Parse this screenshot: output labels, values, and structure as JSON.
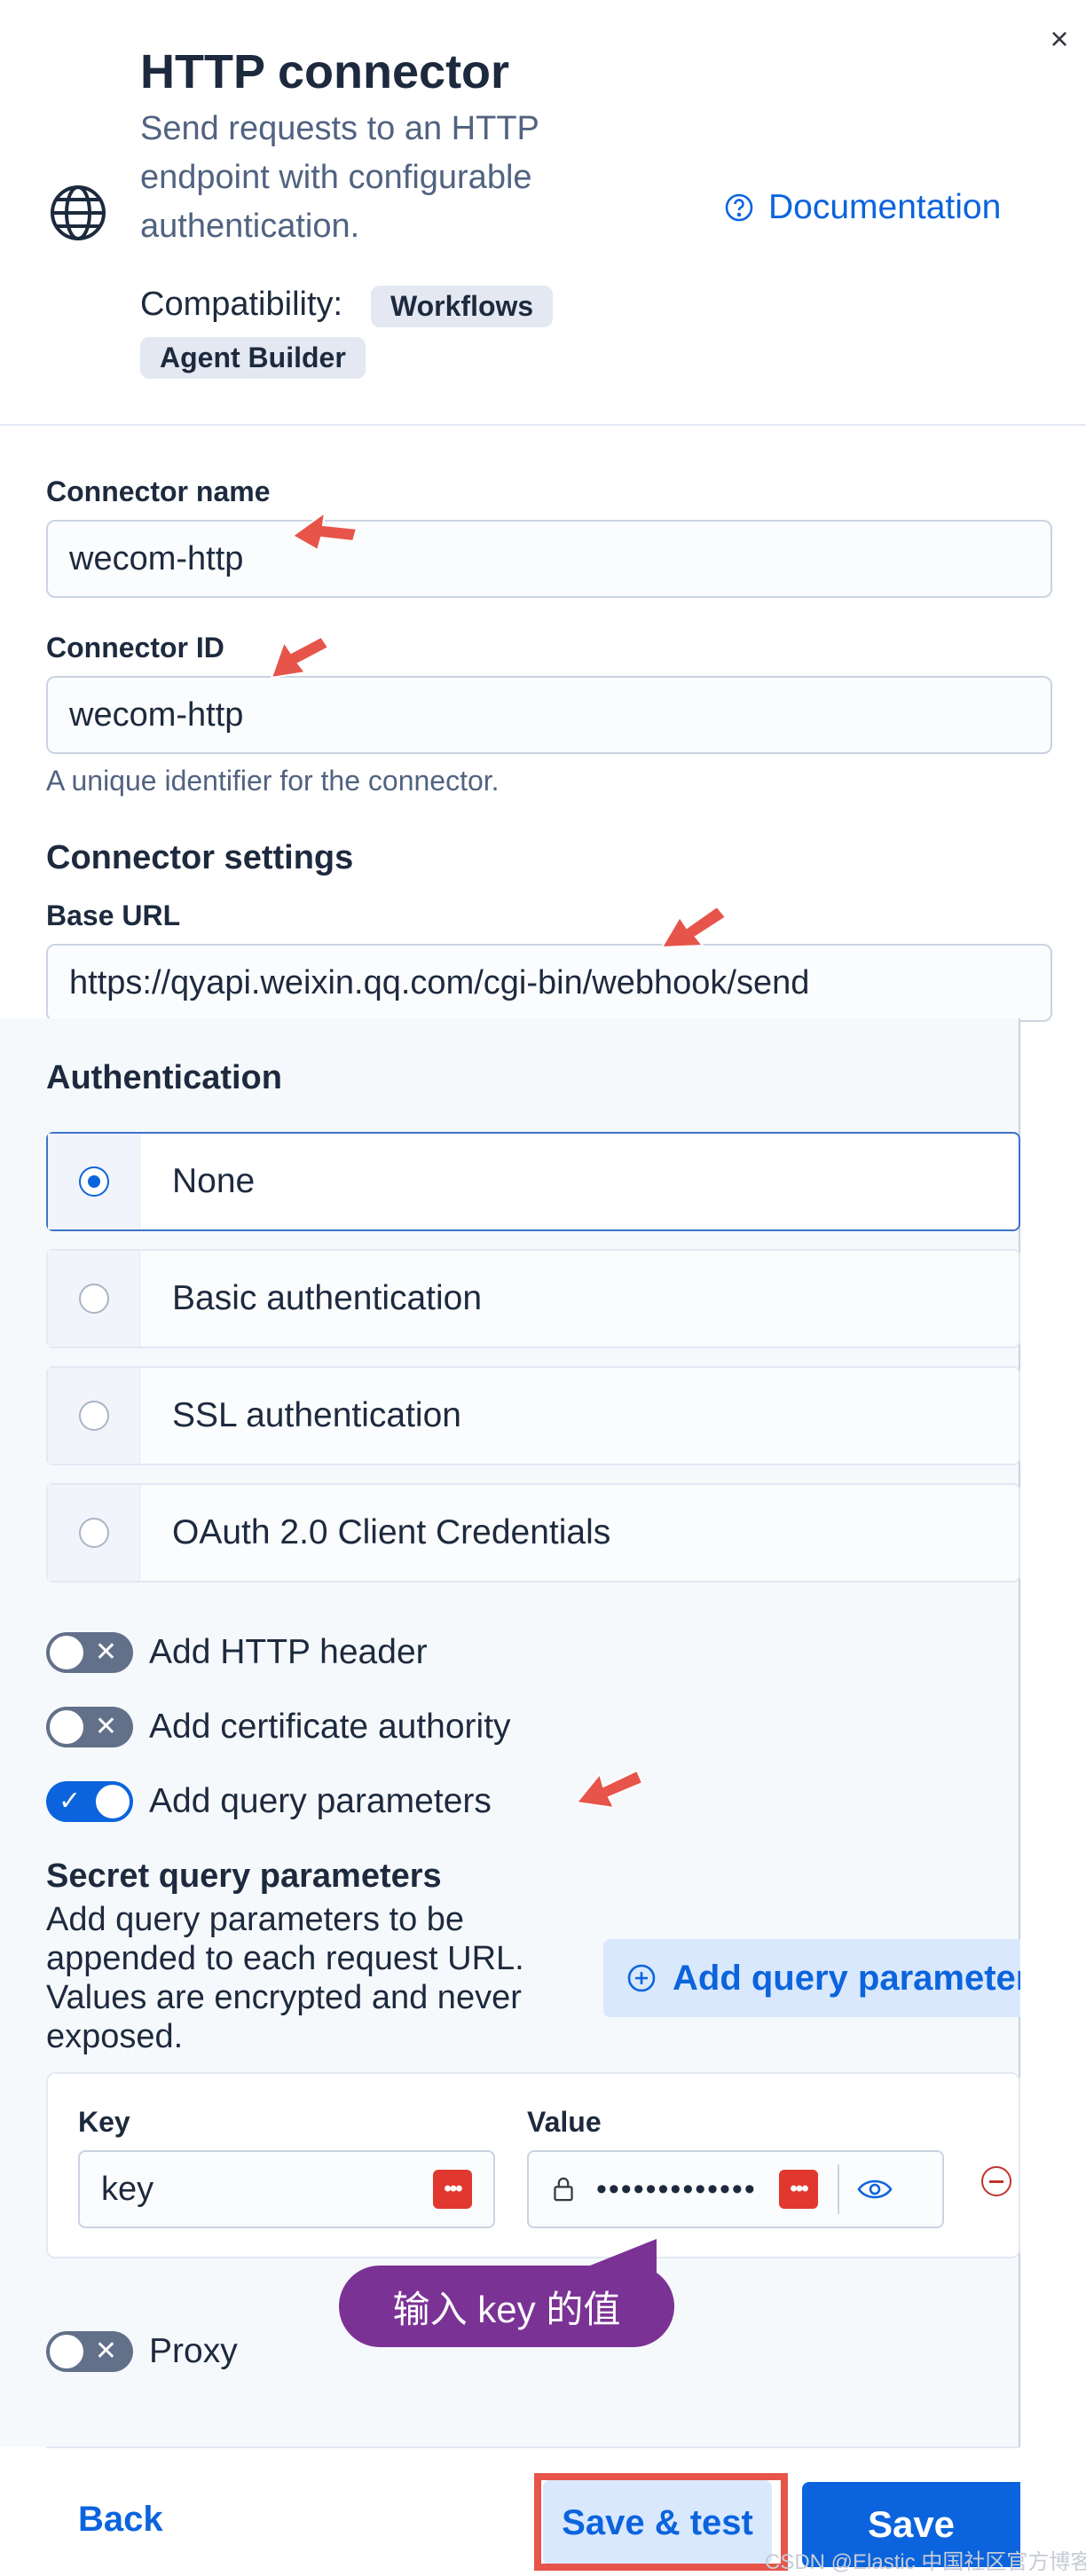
{
  "header": {
    "title": "HTTP connector",
    "description": "Send requests to an HTTP endpoint with configurable authentication.",
    "documentation_label": "Documentation",
    "compatibility_label": "Compatibility:",
    "compatibility_badges": [
      "Workflows",
      "Agent Builder"
    ]
  },
  "form": {
    "connector_name": {
      "label": "Connector name",
      "value": "wecom-http"
    },
    "connector_id": {
      "label": "Connector ID",
      "value": "wecom-http",
      "help": "A unique identifier for the connector."
    },
    "settings_title": "Connector settings",
    "base_url": {
      "label": "Base URL",
      "value": "https://qyapi.weixin.qq.com/cgi-bin/webhook/send"
    }
  },
  "authentication": {
    "title": "Authentication",
    "options": [
      {
        "label": "None",
        "selected": true
      },
      {
        "label": "Basic authentication",
        "selected": false
      },
      {
        "label": "SSL authentication",
        "selected": false
      },
      {
        "label": "OAuth 2.0 Client Credentials",
        "selected": false
      }
    ]
  },
  "toggles": [
    {
      "label": "Add HTTP header",
      "on": false
    },
    {
      "label": "Add certificate authority",
      "on": false
    },
    {
      "label": "Add query parameters",
      "on": true
    }
  ],
  "secret_params": {
    "title": "Secret query parameters",
    "description": "Add query parameters to be appended to each request URL. Values are encrypted and never exposed.",
    "add_button": "Add query parameter",
    "key_label": "Key",
    "value_label": "Value",
    "key_value": "key",
    "value_masked": "•••••••••••••",
    "password_icon_text": "•••"
  },
  "proxy": {
    "label": "Proxy",
    "on": false
  },
  "annotation": "输入 key 的值",
  "footer": {
    "back": "Back",
    "save_test": "Save & test",
    "save": "Save"
  },
  "watermark": "CSDN @Elastic 中国社区官方博客",
  "colors": {
    "primary": "#0b64dd",
    "annotation_arrow": "#e7544a",
    "tooltip": "#7b3295",
    "title": "#1d2a3e",
    "muted_text": "#516381"
  },
  "icons": [
    "close-icon",
    "globe-icon",
    "help-circle-icon",
    "plus-circle-icon",
    "lock-icon",
    "eye-icon",
    "password-manager-icon",
    "remove-circle-icon"
  ]
}
